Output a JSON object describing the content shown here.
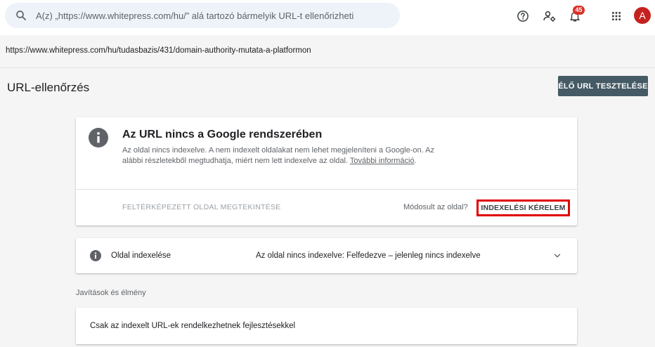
{
  "header": {
    "search_placeholder": "A(z) „https://www.whitepress.com/hu/” alá tartozó bármelyik URL-t ellenőrizheti",
    "icons": [
      "search-icon",
      "help-icon",
      "user-settings-icon",
      "notifications-icon",
      "apps-grid-icon"
    ],
    "notification_count": "45",
    "avatar_letter": "A"
  },
  "inspected_url": "https://www.whitepress.com/hu/tudasbazis/431/domain-authority-mutata-a-platformon",
  "page": {
    "title": "URL-ellenőrzés",
    "live_test_label": "ÉLŐ URL TESZTELÉSE"
  },
  "status_card": {
    "title": "Az URL nincs a Google rendszerében",
    "description": "Az oldal nincs indexelve. A nem indexelt oldalakat nem lehet megjeleníteni a Google-on. Az alábbi részletekből megtudhatja, miért nem lett indexelve az oldal.",
    "more_link": "További információ",
    "more_link_suffix": ".",
    "view_crawled_label": "FELTÉRKÉPEZETT OLDAL MEGTEKINTÉSE",
    "changed_question": "Módosult az oldal?",
    "request_index_label": "INDEXELÉSI KÉRELEM"
  },
  "indexing_card": {
    "label": "Oldal indexelése",
    "value": "Az oldal nincs indexelve: Felfedezve – jelenleg nincs indexelve"
  },
  "enhancements": {
    "section_label": "Javítások és élmény",
    "text": "Csak az indexelt URL-ek rendelkezhetnek fejlesztésekkel"
  },
  "colors": {
    "accent_button": "#455a64",
    "highlight_border": "#e00000",
    "badge": "#d93025",
    "avatar": "#c5221f"
  }
}
